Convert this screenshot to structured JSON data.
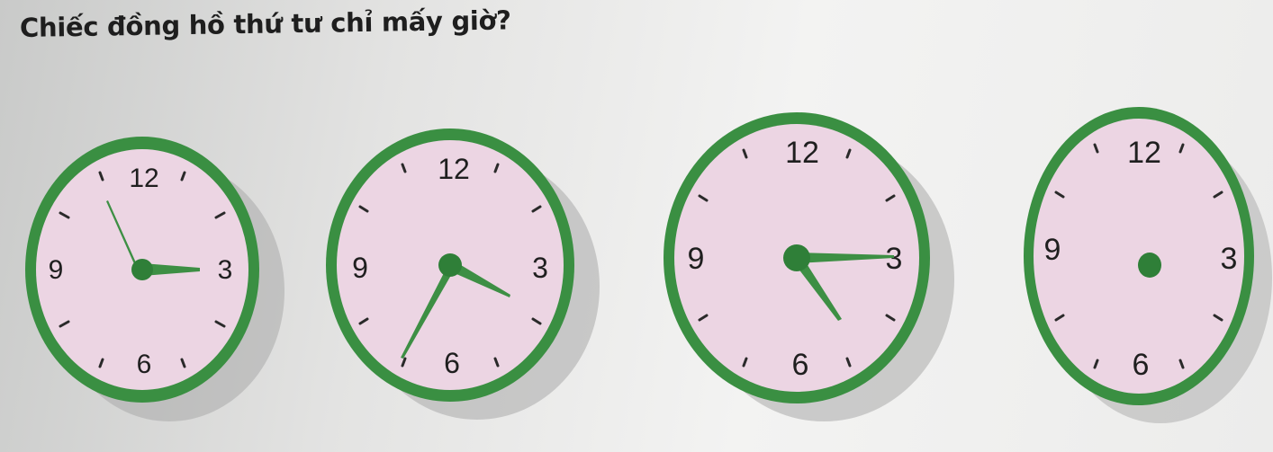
{
  "question": "Chiếc đồng hồ thứ tư chỉ mấy giờ?",
  "colors": {
    "rim": "#3a8f42",
    "face": "#ecd5e3",
    "hand": "#3d8f44",
    "tick": "#2a2a2a",
    "numeral": "#1f1f1f"
  },
  "clocks": [
    {
      "name": "clock-1",
      "numerals": [
        "12",
        "3",
        "6",
        "9"
      ],
      "time": "3:55",
      "hands_visible": true
    },
    {
      "name": "clock-2",
      "numerals": [
        "12",
        "3",
        "6",
        "9"
      ],
      "time": "4:35",
      "hands_visible": true
    },
    {
      "name": "clock-3",
      "numerals": [
        "12",
        "3",
        "6",
        "9"
      ],
      "time": "4:15",
      "hands_visible": true
    },
    {
      "name": "clock-4",
      "numerals": [
        "12",
        "3",
        "6",
        "9"
      ],
      "time": "",
      "hands_visible": false
    }
  ]
}
